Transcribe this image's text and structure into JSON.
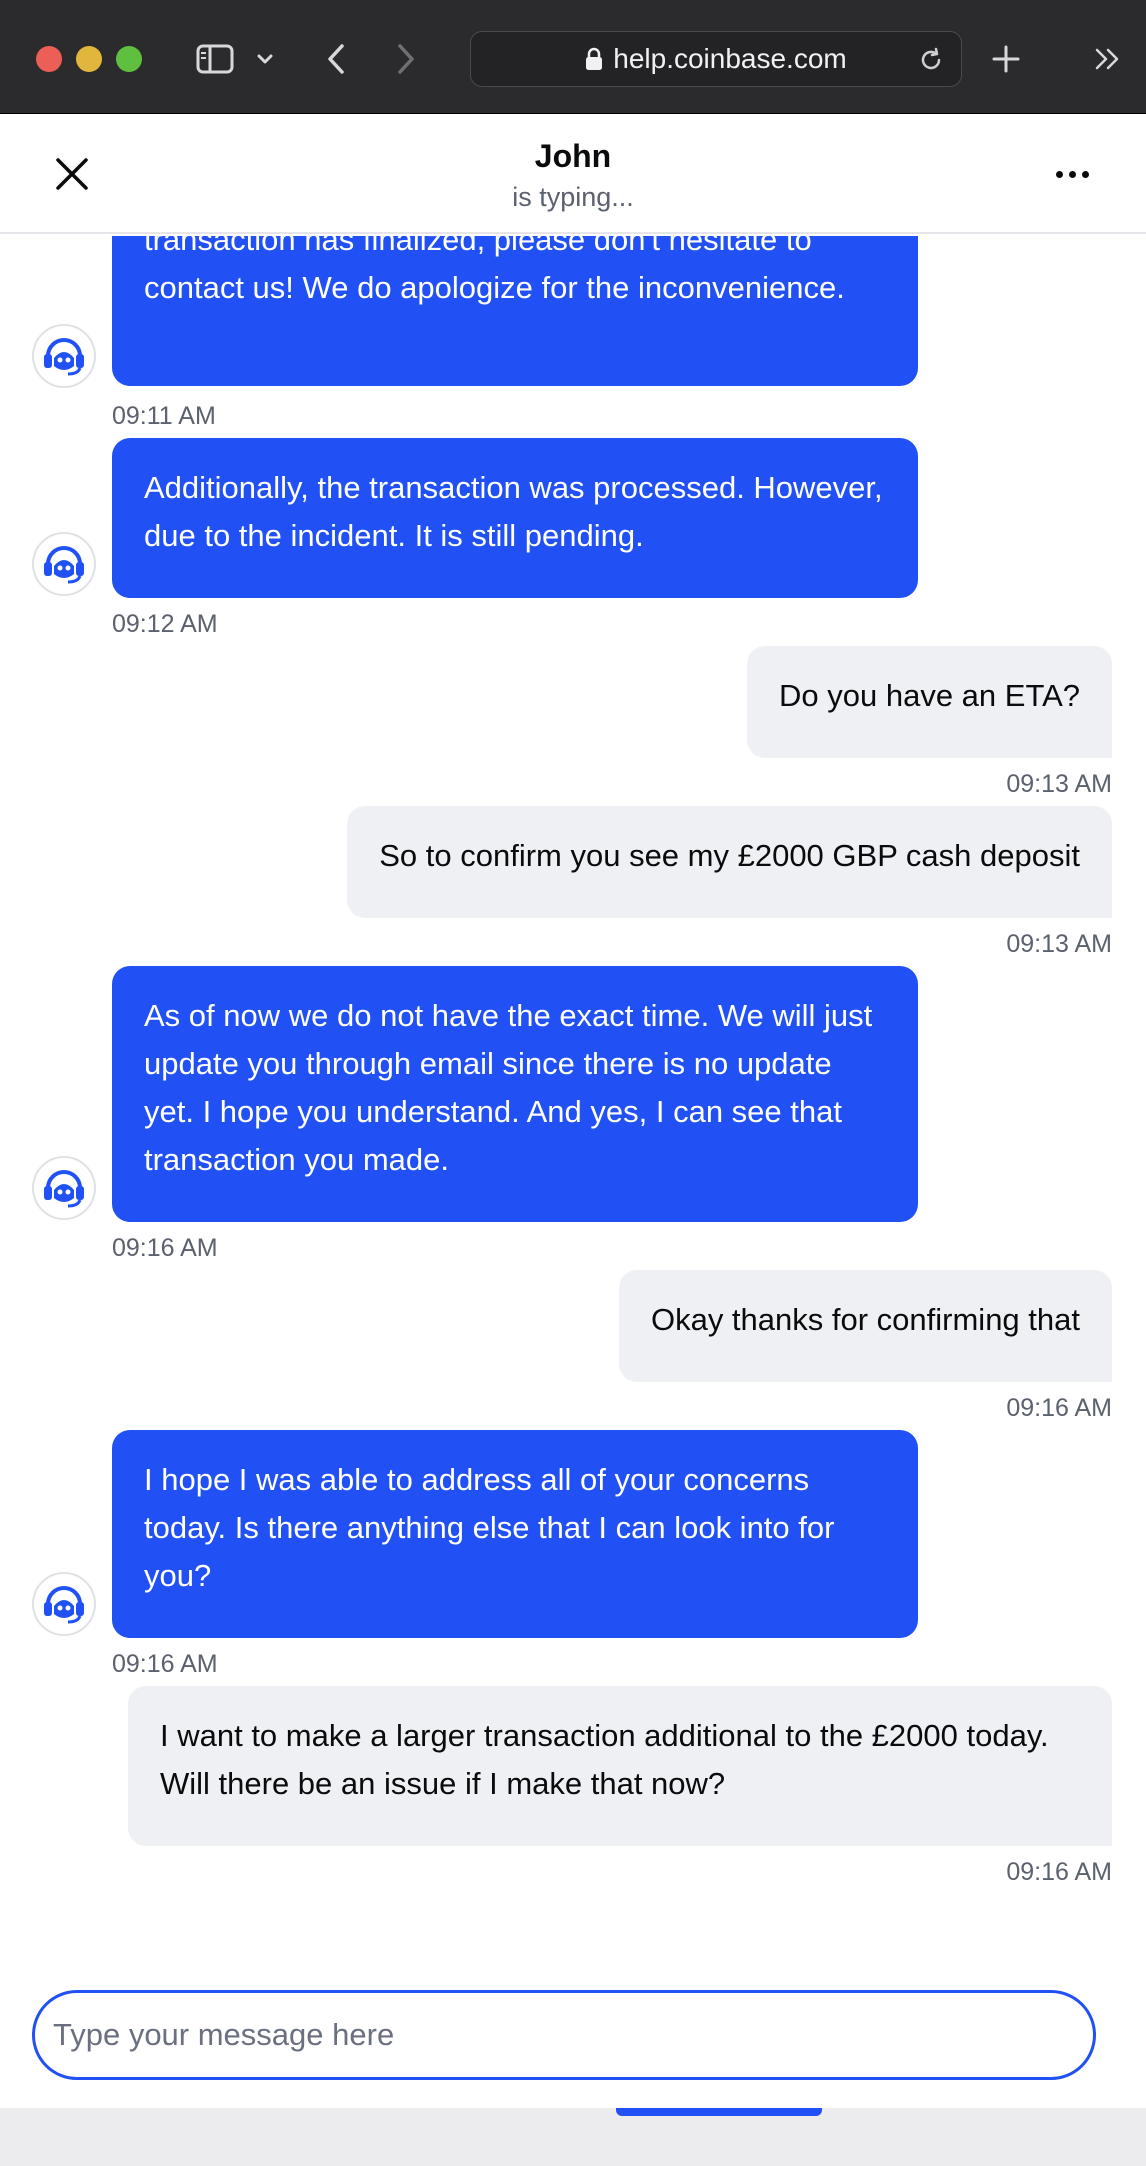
{
  "browser": {
    "url": "help.coinbase.com"
  },
  "header": {
    "agent_name": "John",
    "status": "is typing..."
  },
  "messages": [
    {
      "sender": "agent",
      "text": "transaction has finalized, please don't hesitate to contact us! We do apologize for the inconvenience.",
      "time": "09:11 AM"
    },
    {
      "sender": "agent",
      "text": "Additionally, the transaction was processed. However, due to the incident. It is still pending.",
      "time": "09:12 AM"
    },
    {
      "sender": "user",
      "text": "Do you have an ETA?",
      "time": "09:13 AM"
    },
    {
      "sender": "user",
      "text": "So to confirm you see my £2000 GBP cash deposit",
      "time": "09:13 AM"
    },
    {
      "sender": "agent",
      "text": "As of now we do not have the exact time. We will just update you through email since there is no update yet. I hope you understand. And yes, I can see that transaction you made.",
      "time": "09:16 AM"
    },
    {
      "sender": "user",
      "text": "Okay thanks for confirming that",
      "time": "09:16 AM"
    },
    {
      "sender": "agent",
      "text": "I hope I was able to address all of your concerns today. Is there anything else that I can look into for you?",
      "time": "09:16 AM"
    },
    {
      "sender": "user",
      "text": "I want to make a larger transaction additional to the £2000 today. Will there be an issue if I make that now?",
      "time": "09:16 AM"
    }
  ],
  "composer": {
    "placeholder": "Type your message here",
    "value": ""
  },
  "colors": {
    "accent": "#2151f5",
    "user_bubble": "#eff0f3"
  }
}
